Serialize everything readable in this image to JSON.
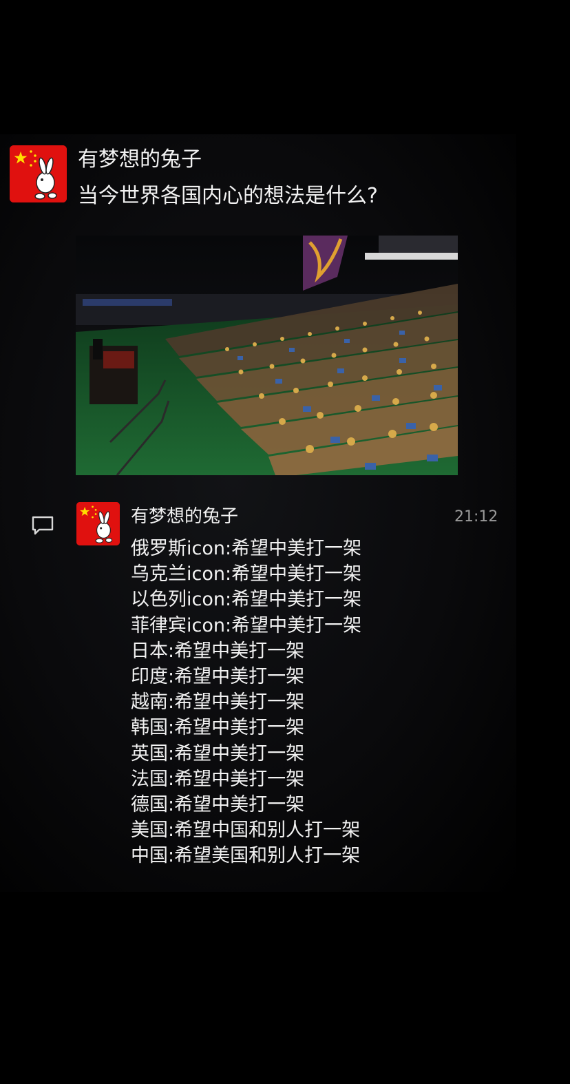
{
  "post": {
    "username": "有梦想的兔子",
    "text": "当今世界各国内心的想法是什么?",
    "avatar_icon": "rabbit-flag-avatar",
    "image_icon": "un-general-assembly-photo"
  },
  "reply": {
    "username": "有梦想的兔子",
    "time": "21:12",
    "avatar_icon": "rabbit-flag-avatar",
    "comment_icon": "comment-bubble-icon",
    "lines": [
      "俄罗斯icon:希望中美打一架",
      "乌克兰icon:希望中美打一架",
      "以色列icon:希望中美打一架",
      "菲律宾icon:希望中美打一架",
      "日本:希望中美打一架",
      "印度:希望中美打一架",
      "越南:希望中美打一架",
      "韩国:希望中美打一架",
      "英国:希望中美打一架",
      "法国:希望中美打一架",
      "德国:希望中美打一架",
      "美国:希望中国和别人打一架",
      "中国:希望美国和别人打一架"
    ]
  },
  "colors": {
    "background": "#000000",
    "text": "#f2f2f2",
    "timestamp": "#9a9a9a",
    "avatar_red": "#e0110f",
    "star_yellow": "#ffde00"
  }
}
